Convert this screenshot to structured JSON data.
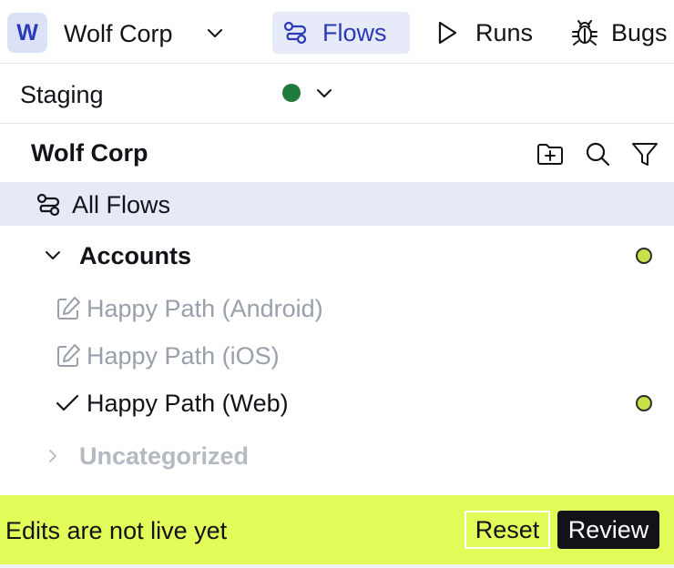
{
  "org": {
    "badge": "W",
    "name": "Wolf Corp"
  },
  "tabs": {
    "flows": "Flows",
    "runs": "Runs",
    "bugs": "Bugs"
  },
  "environment": {
    "name": "Staging",
    "status_color": "#1f7a3c"
  },
  "project": {
    "title": "Wolf Corp"
  },
  "all_flows_label": "All Flows",
  "tree": {
    "folder_accounts": {
      "label": "Accounts",
      "status_color": "#c8e04a"
    },
    "flows": [
      {
        "label": "Happy Path (Android)",
        "state_icon": "edit-icon"
      },
      {
        "label": "Happy Path (iOS)",
        "state_icon": "edit-icon"
      },
      {
        "label": "Happy Path (Web)",
        "state_icon": "check-icon",
        "status_color": "#c8e04a"
      }
    ],
    "folder_uncategorized": {
      "label": "Uncategorized"
    }
  },
  "banner": {
    "message": "Edits are not live yet",
    "reset_label": "Reset",
    "review_label": "Review",
    "color": "#e2fb59"
  },
  "colors": {
    "accent": "#2b3bb8",
    "selected_bg": "#e6eaf7"
  }
}
